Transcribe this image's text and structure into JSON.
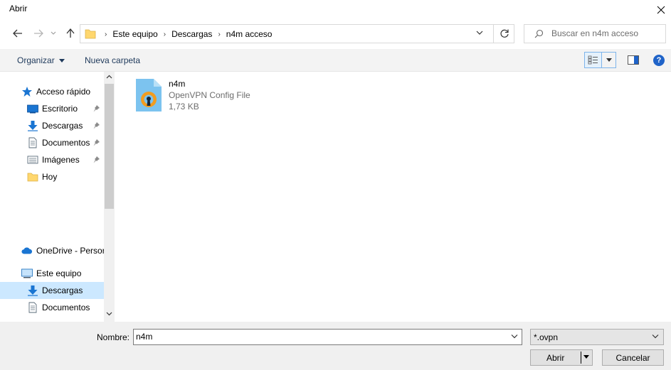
{
  "window": {
    "title": "Abrir"
  },
  "address": {
    "crumbs": [
      "Este equipo",
      "Descargas",
      "n4m acceso"
    ]
  },
  "search": {
    "placeholder": "Buscar en n4m acceso"
  },
  "toolbar": {
    "organize_label": "Organizar",
    "new_folder_label": "Nueva carpeta"
  },
  "sidebar": {
    "items": [
      {
        "label": "Acceso rápido",
        "icon": "star-icon"
      },
      {
        "label": "Escritorio",
        "icon": "desktop-icon",
        "pinned": true
      },
      {
        "label": "Descargas",
        "icon": "download-icon",
        "pinned": true
      },
      {
        "label": "Documentos",
        "icon": "document-icon",
        "pinned": true
      },
      {
        "label": "Imágenes",
        "icon": "image-icon",
        "pinned": true
      },
      {
        "label": "Hoy",
        "icon": "folder-icon"
      },
      {
        "label": "OneDrive - Persor",
        "icon": "cloud-icon"
      },
      {
        "label": "Este equipo",
        "icon": "computer-icon"
      },
      {
        "label": "Descargas",
        "icon": "download-icon",
        "selected": true
      },
      {
        "label": "Documentos",
        "icon": "document-icon"
      }
    ]
  },
  "files": [
    {
      "name": "n4m",
      "type": "OpenVPN Config File",
      "size": "1,73 KB",
      "icon": "openvpn-file-icon"
    }
  ],
  "bottom": {
    "name_label": "Nombre:",
    "name_value": "n4m",
    "filter_value": "*.ovpn",
    "open_label": "Abrir",
    "cancel_label": "Cancelar"
  },
  "colors": {
    "accent": "#1f63c8",
    "selection": "#cce8ff",
    "openvpn_orange": "#f29c1f"
  }
}
